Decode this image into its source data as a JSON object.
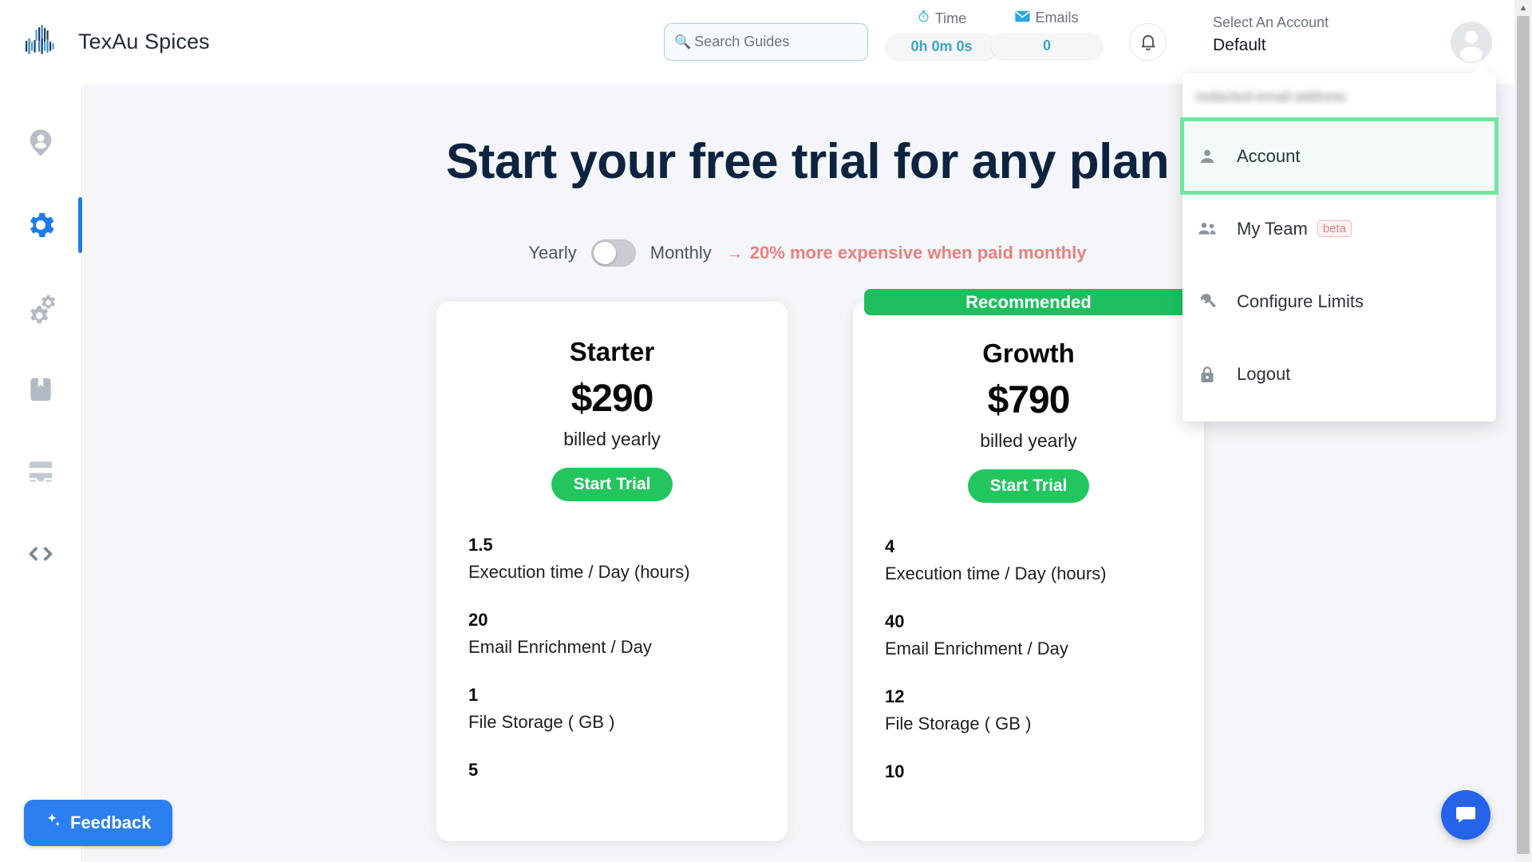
{
  "brand": {
    "title": "TexAu Spices",
    "logo_icon": "texau-bars-logo"
  },
  "search": {
    "placeholder": "Search Guides",
    "value": "",
    "icon": "search-icon"
  },
  "stats": [
    {
      "key": "time",
      "label": "Time",
      "value": "0h 0m 0s",
      "icon": "stopwatch-icon",
      "accent": "#3aa8c4"
    },
    {
      "key": "emails",
      "label": "Emails",
      "value": "0",
      "icon": "envelope-icon",
      "accent": "#3aa8c4"
    }
  ],
  "notifications": {
    "icon": "bell-icon"
  },
  "account_selector": {
    "label": "Select An Account",
    "value": "Default",
    "avatar_icon": "avatar-icon"
  },
  "sidebar": {
    "items": [
      {
        "name": "account",
        "icon": "person-pin-icon",
        "active": false
      },
      {
        "name": "settings",
        "icon": "gear-icon",
        "active": true
      },
      {
        "name": "workflows",
        "icon": "double-gear-icon",
        "active": false
      },
      {
        "name": "guides",
        "icon": "bookmark-icon",
        "active": false
      },
      {
        "name": "inbox",
        "icon": "inbox-icon",
        "active": false
      },
      {
        "name": "developer",
        "icon": "code-brackets-icon",
        "active": false
      }
    ]
  },
  "feedback_button": {
    "label": "Feedback",
    "icon": "sparkles-icon",
    "color": "#2b7ff0"
  },
  "main": {
    "hero_title": "Start your free trial for any plan",
    "billing_toggle": {
      "left_label": "Yearly",
      "right_label": "Monthly",
      "state": "yearly",
      "note": "20% more expensive when paid monthly",
      "note_arrow": "→",
      "note_color": "#e8817e"
    },
    "plans": [
      {
        "name": "Starter",
        "price": "$290",
        "cycle": "billed yearly",
        "cta": "Start Trial",
        "recommended": false,
        "ribbon": "",
        "features": [
          {
            "value": "1.5",
            "name": "Execution time / Day (hours)"
          },
          {
            "value": "20",
            "name": "Email Enrichment / Day"
          },
          {
            "value": "1",
            "name": "File Storage ( GB )"
          },
          {
            "value": "5",
            "name": ""
          }
        ]
      },
      {
        "name": "Growth",
        "price": "$790",
        "cycle": "billed yearly",
        "cta": "Start Trial",
        "recommended": true,
        "ribbon": "Recommended",
        "features": [
          {
            "value": "4",
            "name": "Execution time / Day (hours)"
          },
          {
            "value": "40",
            "name": "Email Enrichment / Day"
          },
          {
            "value": "12",
            "name": "File Storage ( GB )"
          },
          {
            "value": "10",
            "name": ""
          }
        ]
      }
    ]
  },
  "account_dropdown": {
    "email_masked": "redacted-email-address",
    "highlight_color": "#72e6a0",
    "items": [
      {
        "label": "Account",
        "icon": "person-icon",
        "badge": "",
        "highlighted": true
      },
      {
        "label": "My Team",
        "icon": "people-icon",
        "badge": "beta",
        "highlighted": false
      },
      {
        "label": "Configure Limits",
        "icon": "wrench-icon",
        "badge": "",
        "highlighted": false
      },
      {
        "label": "Logout",
        "icon": "lock-icon",
        "badge": "",
        "highlighted": false
      }
    ]
  },
  "chat_widget": {
    "icon": "chat-icon",
    "color": "#2563eb"
  },
  "scrollbar": {
    "up_arrow": "▲",
    "down_arrow": "▼"
  }
}
